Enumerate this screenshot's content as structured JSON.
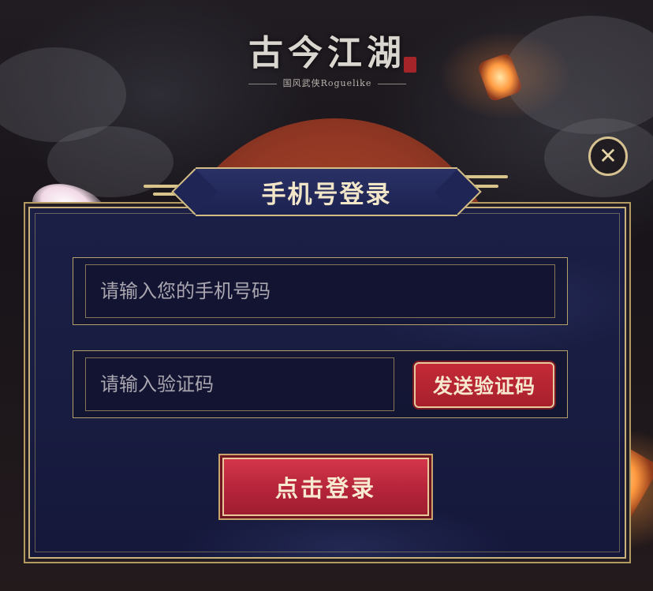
{
  "logo": {
    "title": "古今江湖",
    "subtitle": "国风武侠Roguelike"
  },
  "close": {
    "label": "✕"
  },
  "dialog": {
    "title": "手机号登录",
    "phone_input": {
      "placeholder": "请输入您的手机号码",
      "value": ""
    },
    "code_input": {
      "placeholder": "请输入验证码",
      "value": ""
    },
    "send_code_button": "发送验证码",
    "login_button": "点击登录"
  },
  "colors": {
    "panel_bg": "#1b1f46",
    "gold_border": "#c9b27a",
    "button_red": "#c42a38",
    "button_text": "#f6e8cf"
  }
}
